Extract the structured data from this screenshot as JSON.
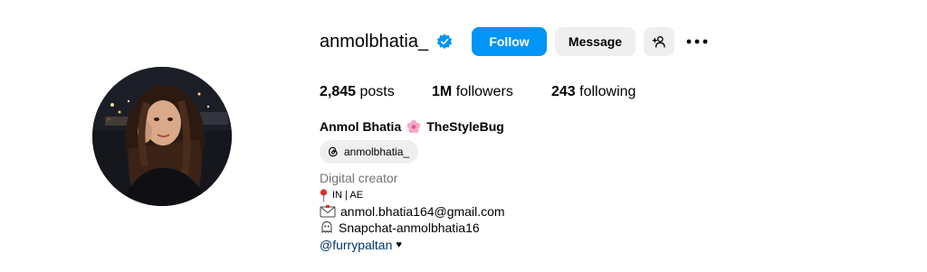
{
  "profile": {
    "username": "anmolbhatia_",
    "follow_label": "Follow",
    "message_label": "Message",
    "stats": {
      "posts_count": "2,845",
      "posts_label": "posts",
      "followers_count": "1M",
      "followers_label": "followers",
      "following_count": "243",
      "following_label": "following"
    },
    "full_name": "Anmol Bhatia",
    "brand": "TheStyleBug",
    "threads_handle": "anmolbhatia_",
    "category": "Digital creator",
    "bio": {
      "location": "IN | AE",
      "email": "anmol.bhatia164@gmail.com",
      "snapchat": "Snapchat-anmolbhatia16",
      "mention": "@furrypaltan",
      "mention_suffix": "♥"
    }
  },
  "icons": {
    "verified": "verified-badge-icon",
    "suggested": "add-person-icon",
    "more": "more-options-icon",
    "threads": "threads-icon",
    "flower": "flower-emoji",
    "pin": "pushpin-emoji",
    "mail": "envelope-emoji",
    "ghost": "ghost-emoji"
  },
  "colors": {
    "primary_button": "#0095f6",
    "secondary_button": "#efefef",
    "verified": "#0095f6",
    "muted_text": "#737373",
    "link_text": "#00376b"
  }
}
